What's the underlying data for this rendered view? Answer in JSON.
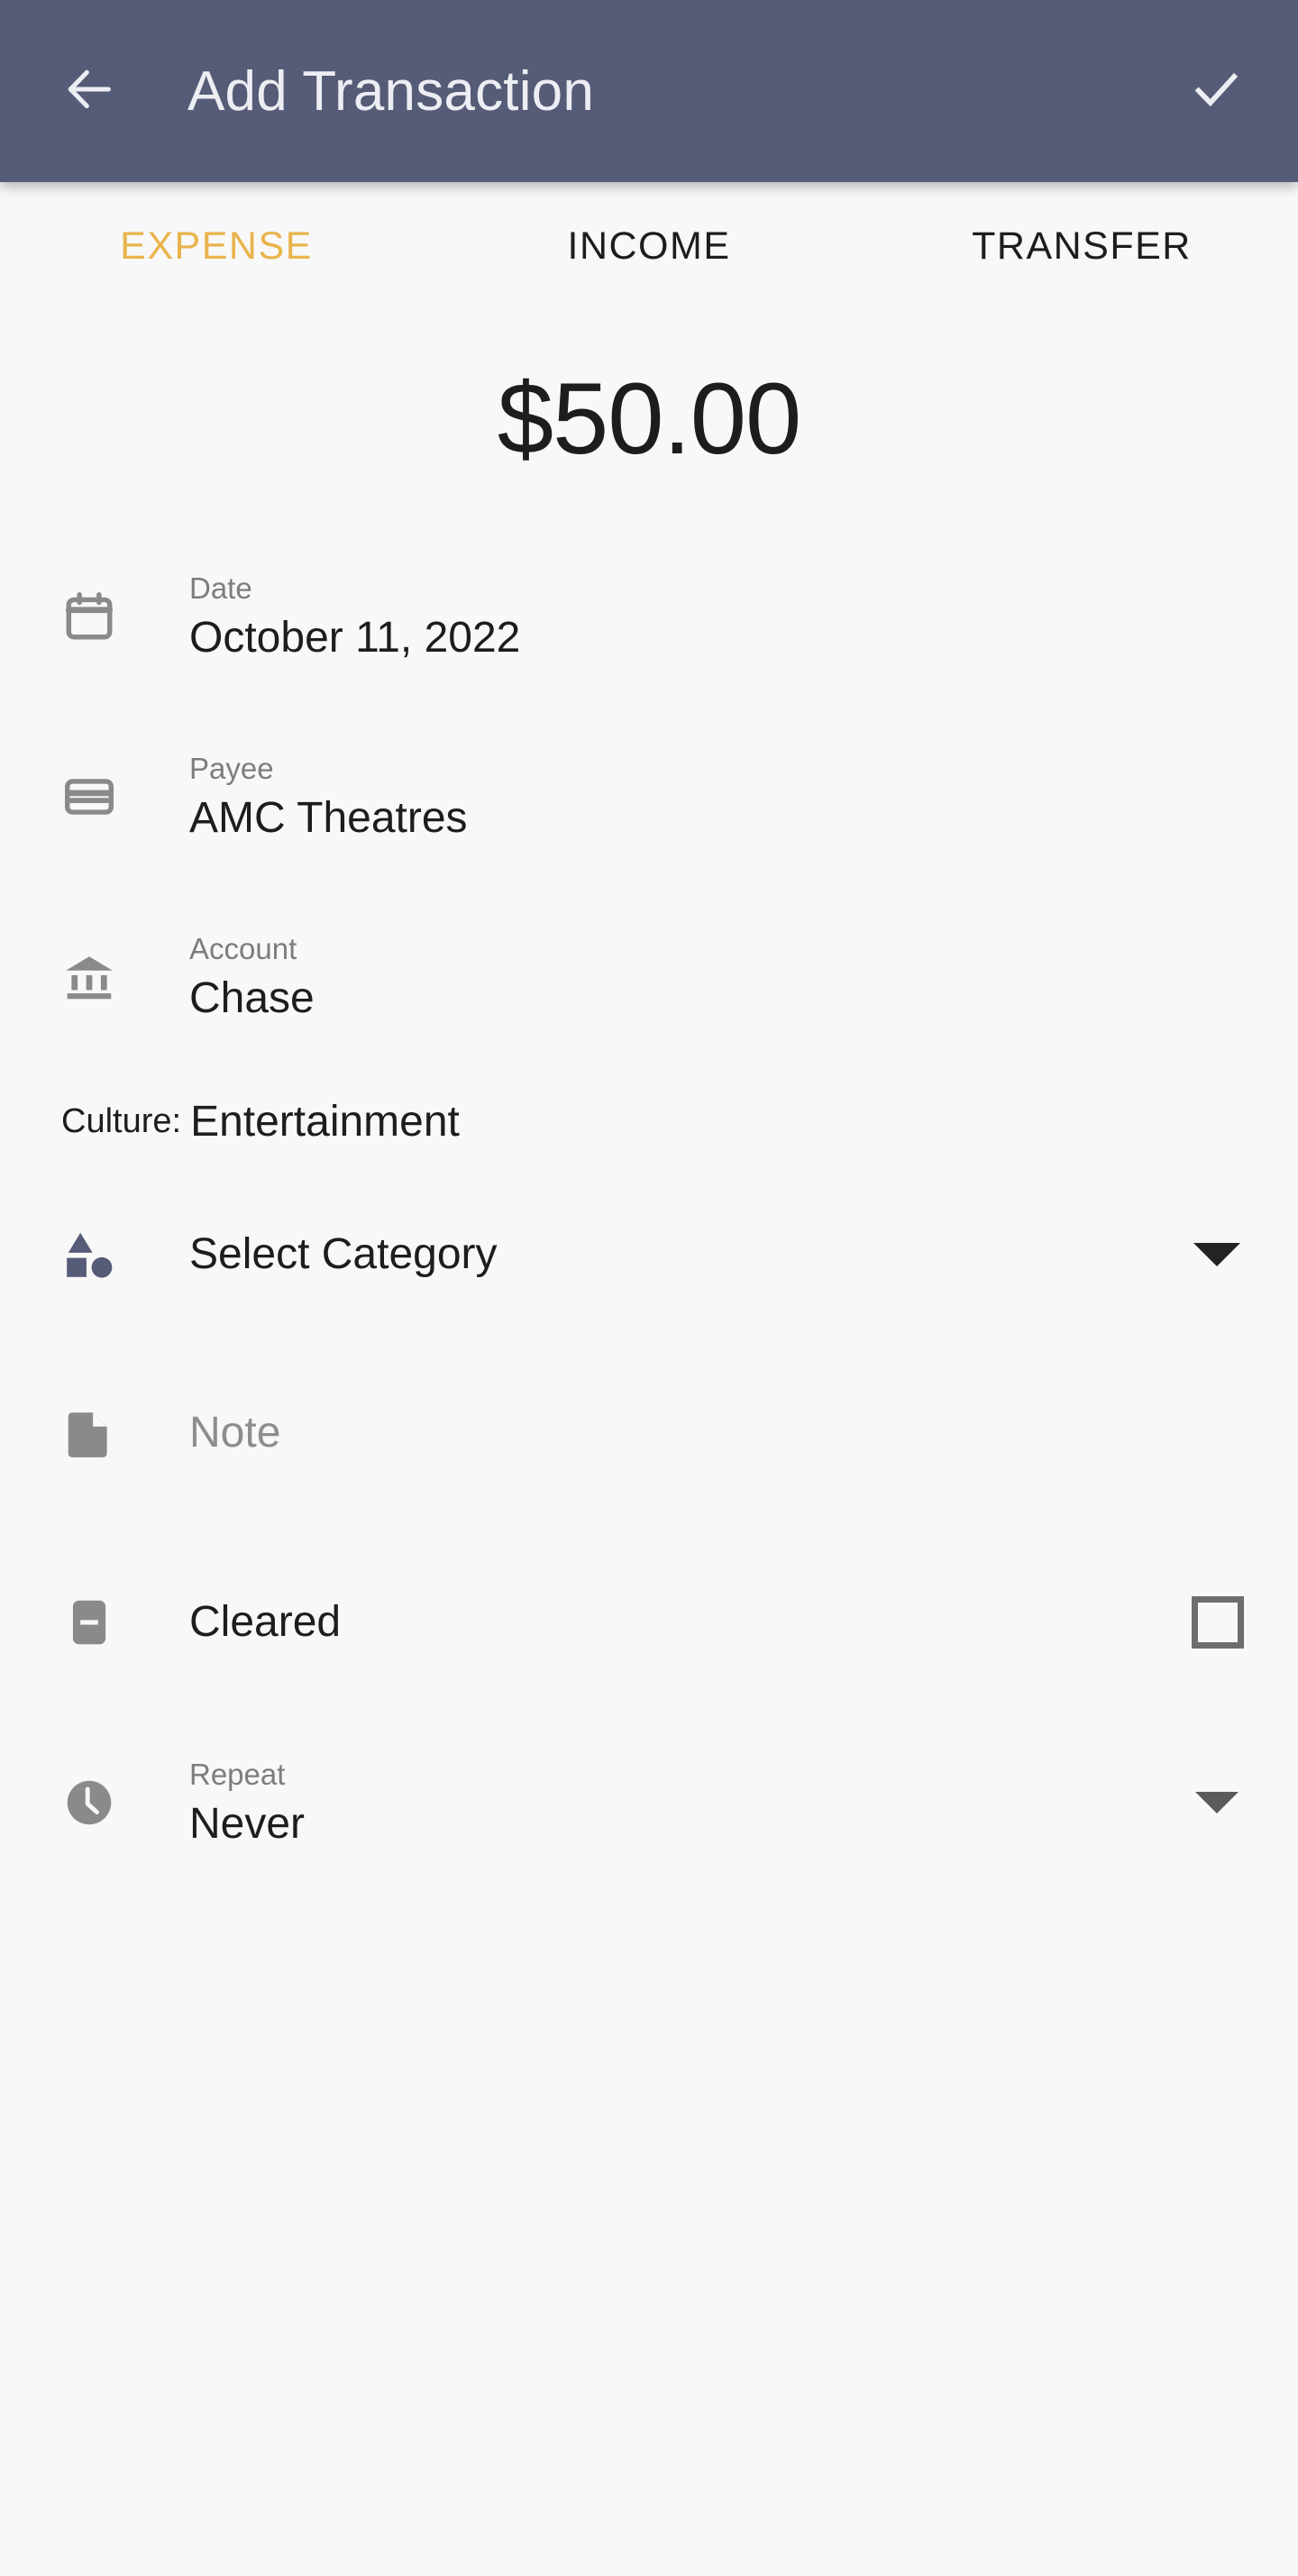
{
  "appbar": {
    "back_icon": "arrow-left-icon",
    "title": "Add Transaction",
    "confirm_icon": "check-icon",
    "background_color": "#565b77",
    "foreground_color": "#eceef3"
  },
  "tabs": {
    "active_color": "#e9b44c",
    "inactive_color": "#1d1d1d",
    "items": [
      {
        "label": "EXPENSE",
        "active": true
      },
      {
        "label": "INCOME",
        "active": false
      },
      {
        "label": "TRANSFER",
        "active": false
      }
    ]
  },
  "amount": {
    "value": "$50.00"
  },
  "fields": {
    "date": {
      "icon": "calendar-icon",
      "label": "Date",
      "value": "October 11, 2022"
    },
    "payee": {
      "icon": "credit-card-icon",
      "label": "Payee",
      "value": "AMC Theatres"
    },
    "account": {
      "icon": "bank-icon",
      "label": "Account",
      "value": "Chase"
    },
    "culture": {
      "key": "Culture:",
      "value": "Entertainment"
    },
    "category": {
      "icon": "shapes-icon",
      "value": "Select Category",
      "caret_icon": "chevron-down-icon"
    },
    "note": {
      "icon": "note-icon",
      "placeholder": "Note",
      "value": "Note"
    },
    "cleared": {
      "icon": "minus-box-icon",
      "label": "Cleared",
      "checked": false,
      "checkbox_icon": "checkbox-unchecked-icon"
    },
    "repeat": {
      "icon": "clock-icon",
      "label": "Repeat",
      "value": "Never",
      "caret_icon": "chevron-down-icon"
    }
  },
  "colors": {
    "page_background": "#f8f8f8",
    "icon_gray": "#8a8a8a",
    "accent_slate": "#565b77",
    "text_primary": "#1d1d1d",
    "text_secondary": "#7d7d7d"
  }
}
